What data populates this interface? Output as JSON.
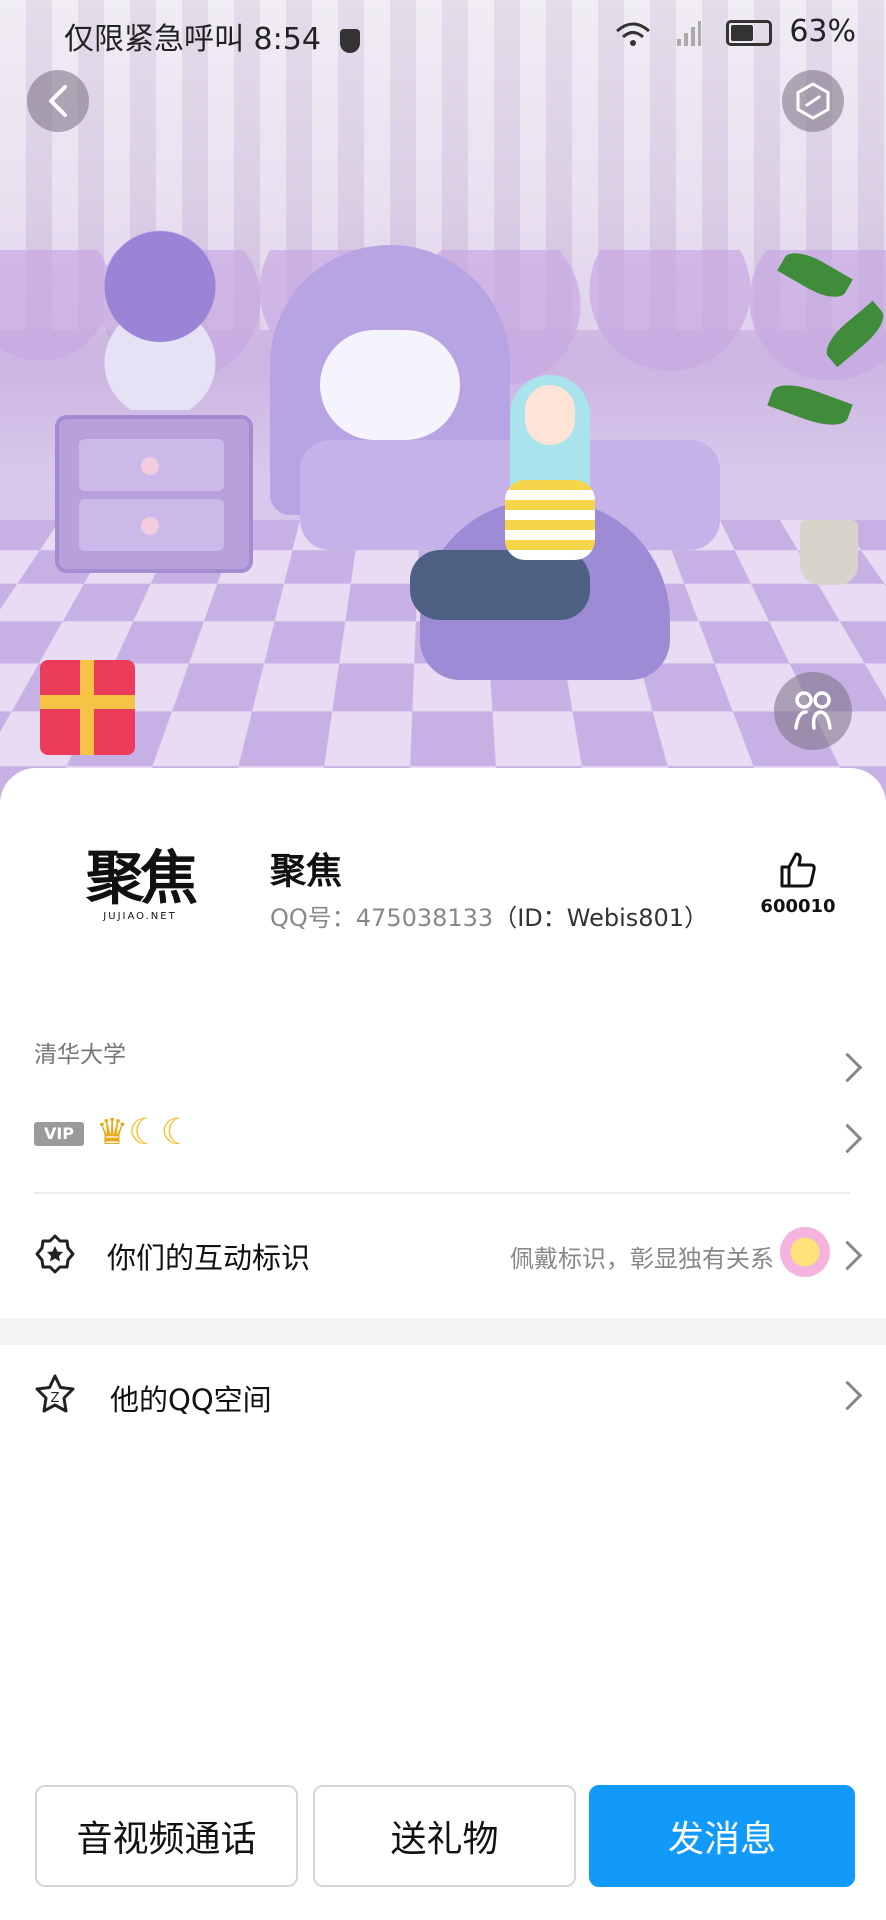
{
  "status_bar": {
    "carrier_text": "仅限紧急呼叫",
    "time": "8:54",
    "battery": "63%"
  },
  "profile": {
    "logo_text": "聚焦",
    "logo_subtext": "JUJIAO.NET",
    "nickname": "聚焦",
    "qq_label": "QQ号：475038133",
    "id_label": "（ID：Webis801）",
    "likes": "600010"
  },
  "info": {
    "school": "清华大学",
    "vip_tag": "VIP",
    "vip_icons": [
      "crown",
      "moon",
      "moon"
    ]
  },
  "interaction": {
    "label": "你们的互动标识",
    "description": "佩戴标识，彰显独有关系"
  },
  "qzone": {
    "label": "他的QQ空间"
  },
  "actions": {
    "call": "音视频通话",
    "gift": "送礼物",
    "message": "发消息"
  },
  "colors": {
    "accent": "#129afa"
  }
}
